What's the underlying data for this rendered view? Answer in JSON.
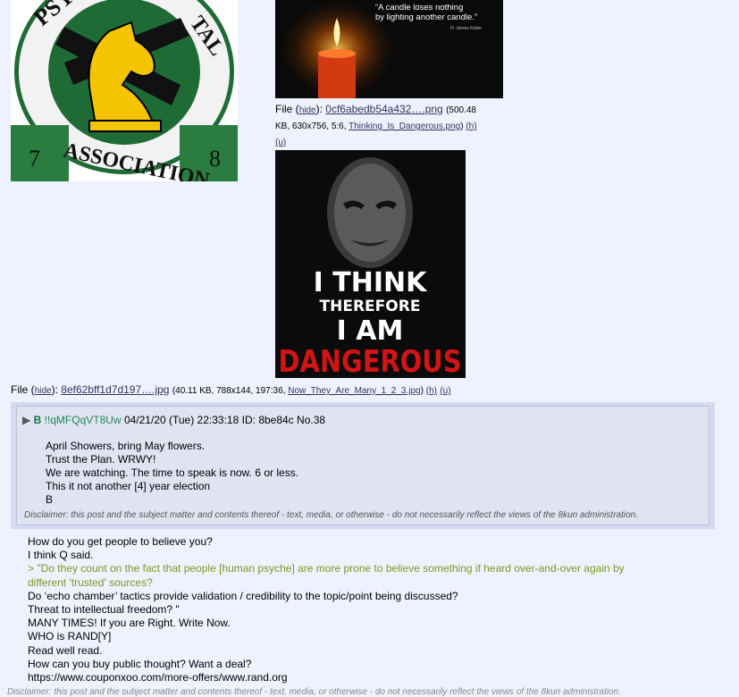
{
  "images": {
    "patch": {
      "text_top": "PSYCH",
      "text_right": "TAL",
      "text_bottom": "ASSOCIATION",
      "num_left": "7",
      "num_right": "8"
    },
    "candle": {
      "quote": "“A candle loses nothing by lighting another candle.”",
      "attribution": "Fr James Keller"
    },
    "poster": {
      "line1": "I THINK",
      "line2": "THEREFORE",
      "line3": "I AM",
      "line4": "DANGEROUS"
    }
  },
  "file1": {
    "label": "File",
    "hide": "hide",
    "filename": "0cf6abedb54a432….png",
    "meta_a": "(500.48",
    "meta_b": "KB, 630x756, 5:6, ",
    "orig": "Thinking_Is_Dangerous.png",
    "h": "(h)",
    "u": "(u)"
  },
  "file2": {
    "label": "File",
    "hide": "hide",
    "filename": "8ef62bff1d7d197….jpg",
    "meta": "(40.11 KB, 788x144, 197:36, ",
    "orig": "Now_They_Are_Many_1_2_3.jpg",
    "h": "(h)",
    "u": "(u)"
  },
  "post": {
    "arrow": "▶",
    "name": "B",
    "trip": "!!qMFQqVT8Uw",
    "date": "04/21/20 (Tue) 22:33:18",
    "id_label": "ID:",
    "id": "8be84c",
    "no_label": "No.",
    "no": "38",
    "lines": [
      "April Showers, bring May flowers.",
      "Trust the Plan. WRWY!",
      "We are watching. The time to speak is now. 6 or less.",
      "This it not another [4] year election",
      "B"
    ],
    "disclaimer": "Disclaimer: this post and the subject matter and contents thereof - text, media, or otherwise - do not necessarily reflect the views of the 8kun administration."
  },
  "op": {
    "lines": [
      "How do you get people to believe you?",
      "I think Q said.",
      "> \"Do they count on the fact that people [human psyche] are more prone to believe something if heard over-and-over again by",
      "different 'trusted' sources?",
      "Do ‘echo chamber’ tactics provide validation / credibility to the topic/point being discussed?",
      "Threat to intellectual freedom? \"",
      "MANY TIMES! If you are Right. Write Now.",
      "WHO is RAND[Y]",
      "Read well read.",
      "How can you buy public thought? Want a deal?",
      "https://www.couponxoo.com/more-offers/www.rand.org"
    ],
    "disclaimer": "Disclaimer: this post and the subject matter and contents thereof - text, media, or otherwise - do not necessarily reflect the views of the 8kun administration."
  },
  "colors": {
    "background": "#eef2ff",
    "reply_bg": "#d6daf0",
    "name": "#117743",
    "quote": "#789922",
    "link": "#34345c"
  }
}
